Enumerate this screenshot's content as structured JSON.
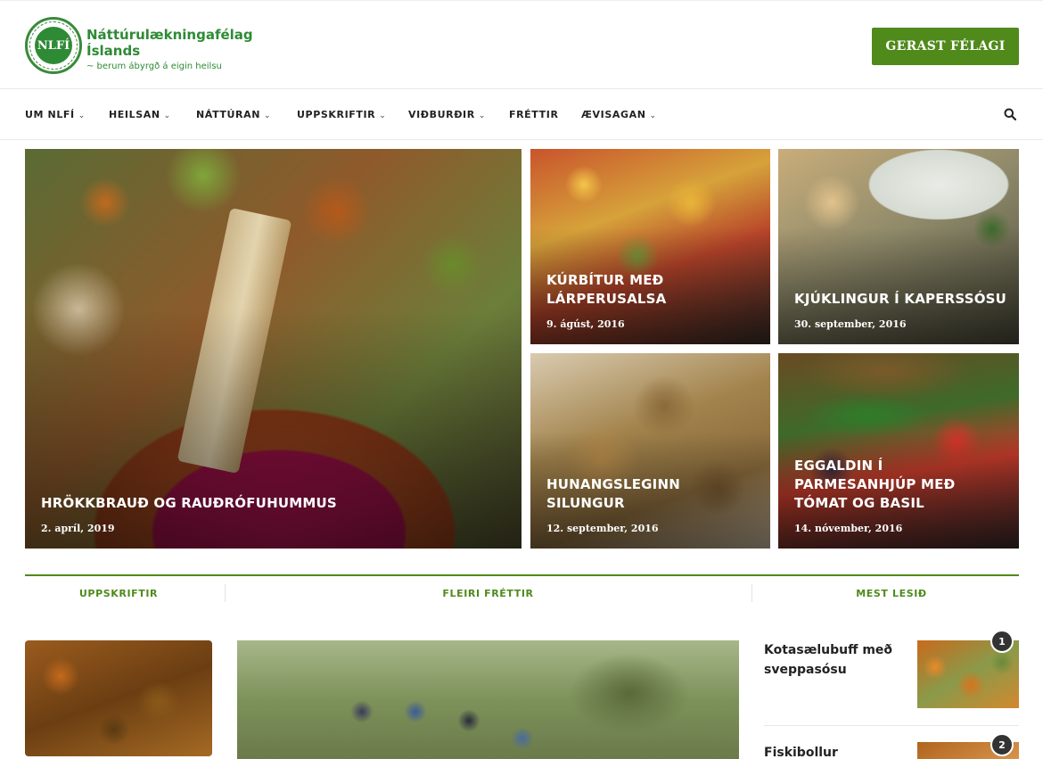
{
  "header": {
    "logo_text": "NLFÍ",
    "brand_line1": "Náttúrulækningafélag",
    "brand_line2": "Íslands",
    "tagline": "~ berum ábyrgð á eigin heilsu",
    "join_button": "GERAST FÉLAGI"
  },
  "nav": {
    "items": [
      {
        "label": "UM NLFÍ",
        "has_dropdown": true
      },
      {
        "label": "HEILSAN",
        "has_dropdown": true
      },
      {
        "label": "NÁTTÚRAN",
        "has_dropdown": true
      },
      {
        "label": "UPPSKRIFTIR",
        "has_dropdown": true
      },
      {
        "label": "VIÐBURÐIR",
        "has_dropdown": true
      },
      {
        "label": "FRÉTTIR",
        "has_dropdown": false
      },
      {
        "label": "ÆVISAGAN",
        "has_dropdown": true
      }
    ],
    "chevron": "⌄",
    "search_icon": "search-icon"
  },
  "featured": [
    {
      "title": "HRÖKKBRAUÐ OG RAUÐRÓFUHUMMUS",
      "date": "2. apríl, 2019"
    },
    {
      "title_lines": [
        "KÚRBÍTUR MEÐ",
        "LÁRPERUSALSA"
      ],
      "date": "9. ágúst, 2016"
    },
    {
      "title_lines": [
        "KJÚKLINGUR Í KAPERSSÓSU"
      ],
      "date": "30. september, 2016"
    },
    {
      "title_lines": [
        "HUNANGSLEGINN",
        "SILUNGUR"
      ],
      "date": "12. september, 2016"
    },
    {
      "title_lines": [
        "EGGALDIN Í",
        "PARMESANHJÚP MEÐ",
        "TÓMAT OG BASIL"
      ],
      "date": "14. nóvember, 2016"
    }
  ],
  "sections": {
    "recipes": "UPPSKRIFTIR",
    "more_news": "FLEIRI FRÉTTIR",
    "most_read": "MEST LESIÐ"
  },
  "most_read": [
    {
      "rank": "1",
      "title_lines": [
        "Kotasælubuff með",
        "sveppasósu"
      ]
    },
    {
      "rank": "2",
      "title_lines": [
        "Fiskibollur"
      ]
    }
  ],
  "colors": {
    "brand_green": "#2f8a35",
    "accent_green": "#4f8a1b"
  }
}
